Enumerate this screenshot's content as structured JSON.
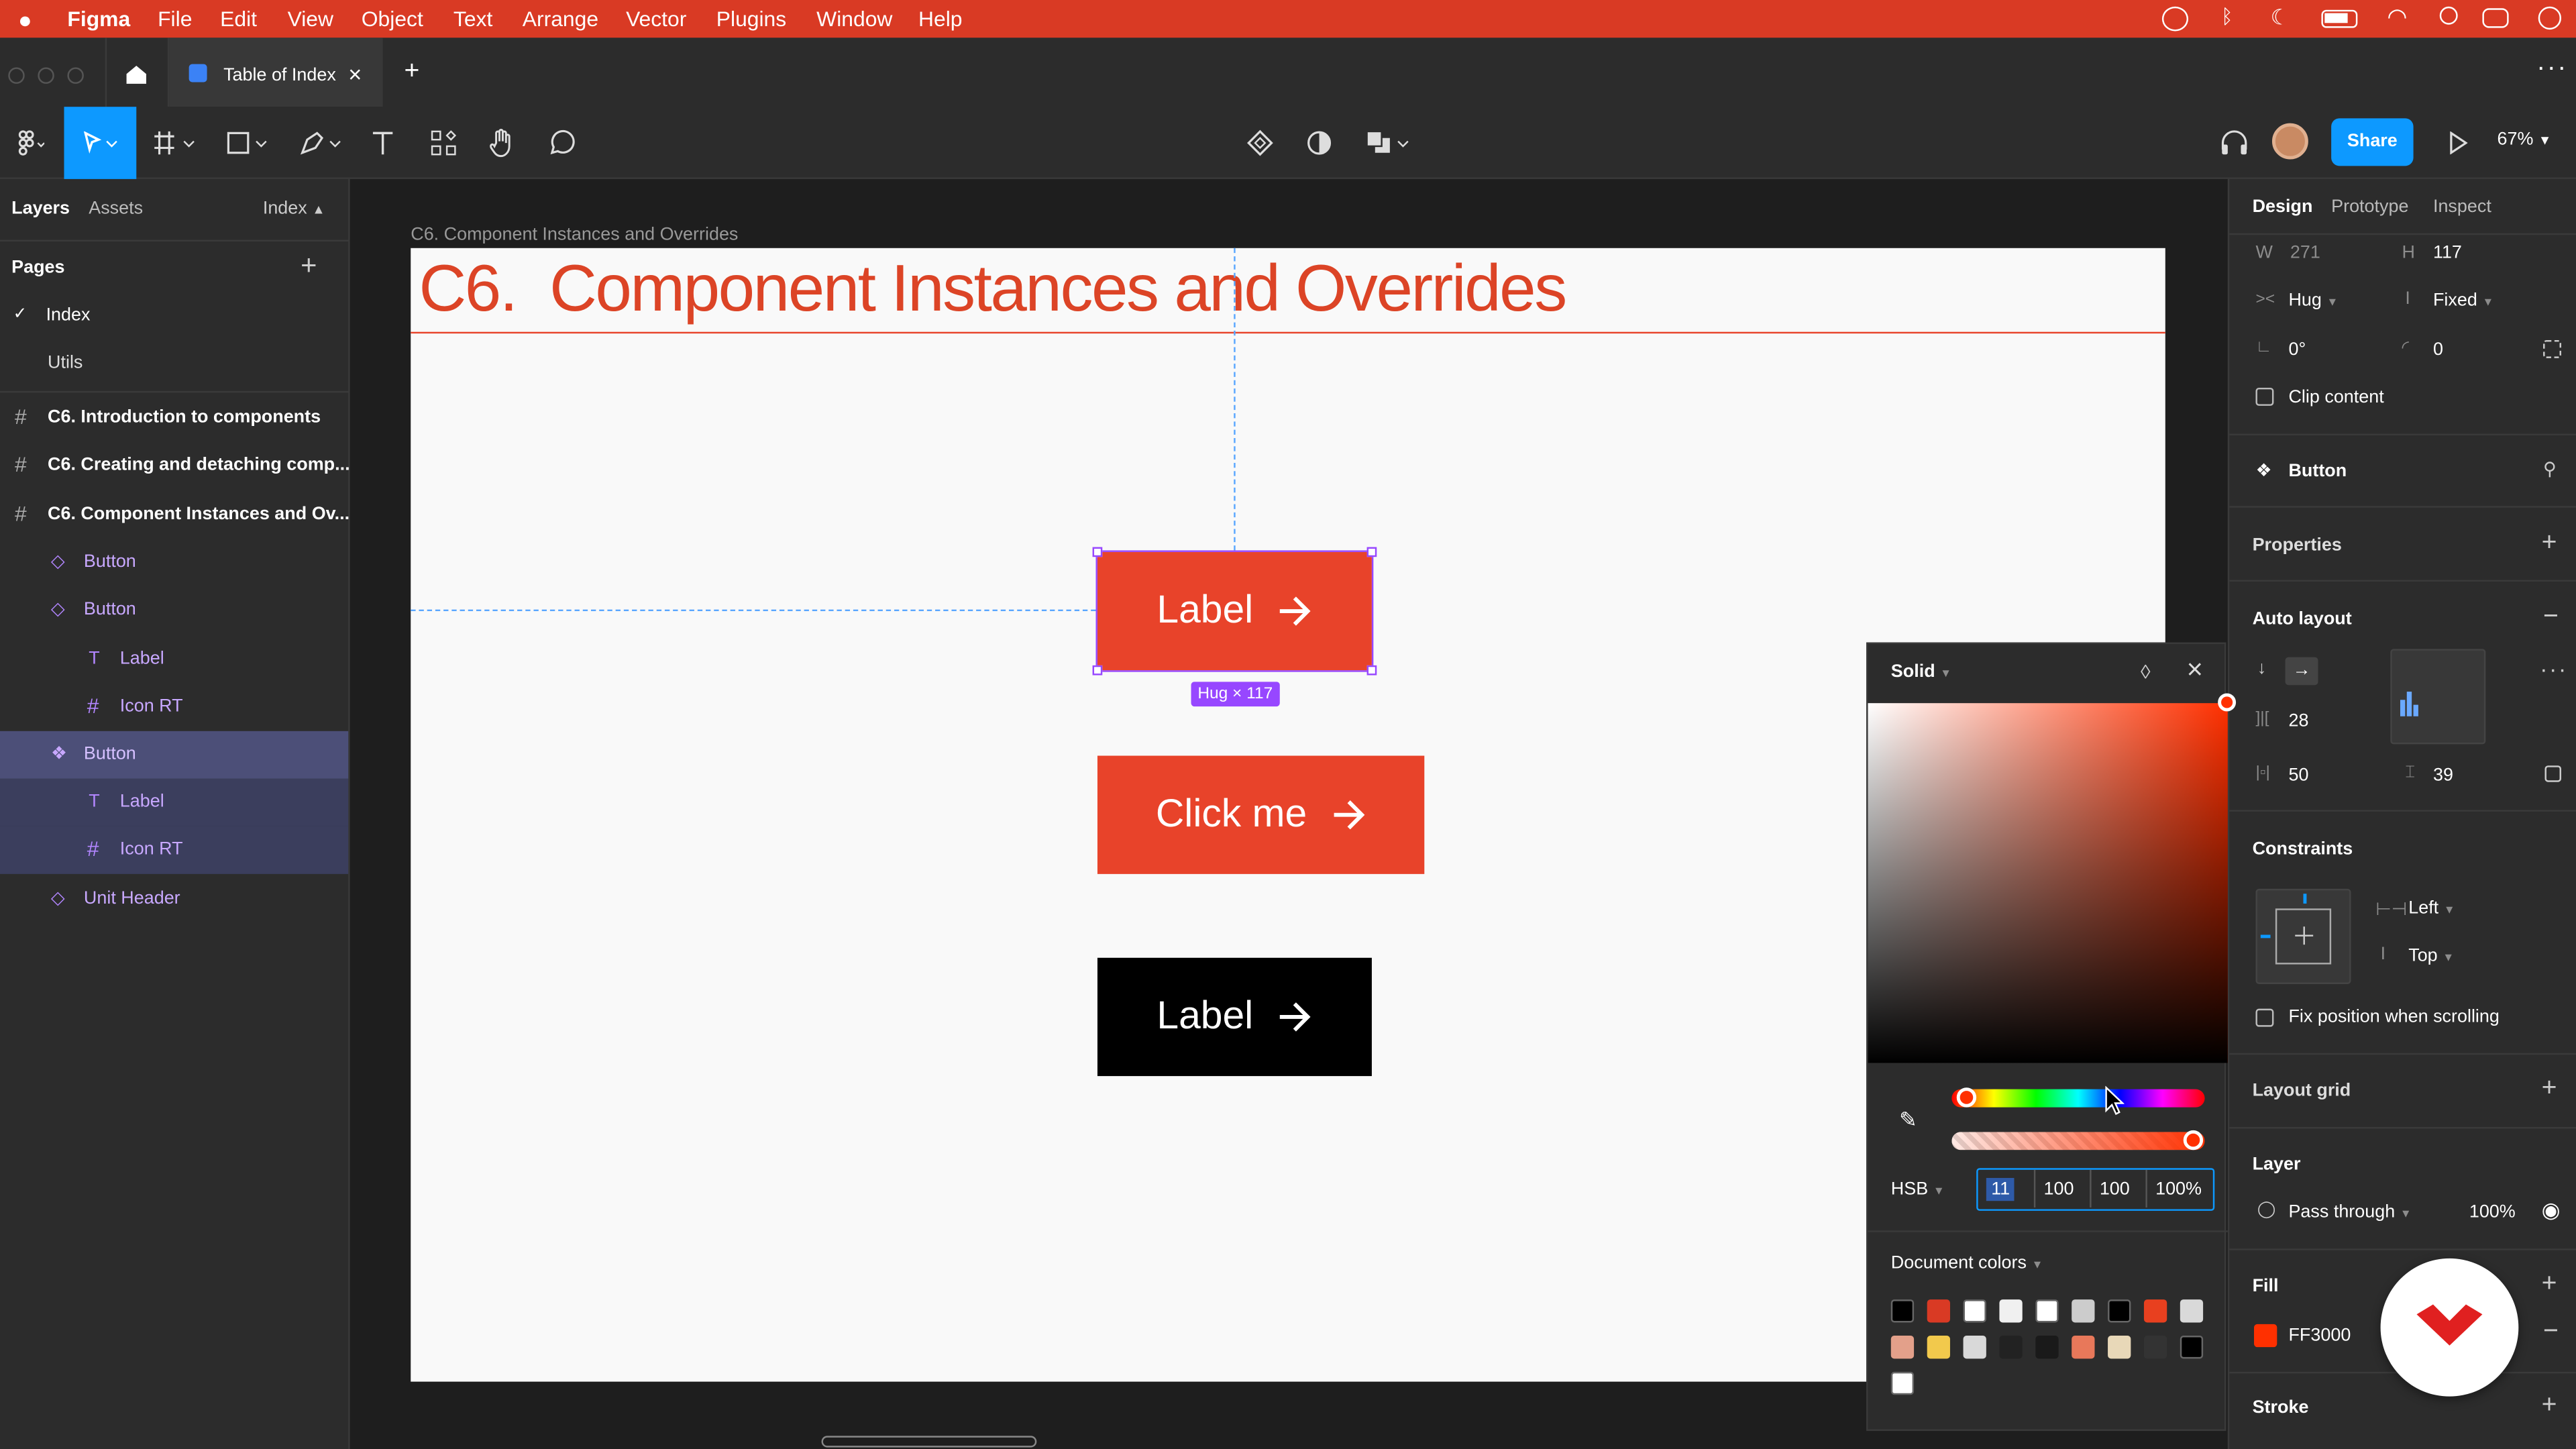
{
  "menubar": {
    "app": "Figma",
    "items": [
      "File",
      "Edit",
      "View",
      "Object",
      "Text",
      "Arrange",
      "Vector",
      "Plugins",
      "Window",
      "Help"
    ]
  },
  "tab": {
    "title": "Table of Index"
  },
  "toolbar": {
    "share": "Share",
    "zoom": "67%"
  },
  "left": {
    "tabs": {
      "layers": "Layers",
      "assets": "Assets",
      "page": "Index"
    },
    "pages_title": "Pages",
    "pages": [
      "Index",
      "Utils"
    ],
    "frames": [
      "C6. Introduction to components",
      "C6. Creating and detaching comp...",
      "C6. Component Instances and Ov..."
    ],
    "layers": [
      "Button",
      "Button",
      "Label",
      "Icon RT",
      "Button",
      "Label",
      "Icon RT",
      "Unit Header"
    ]
  },
  "canvas": {
    "frame_label": "C6. Component Instances and Overrides",
    "heading": "C6.  Component Instances and Overrides",
    "btn1": "Label",
    "btn2": "Click me",
    "btn3": "Label",
    "size_badge": "Hug × 117"
  },
  "right": {
    "tabs": [
      "Design",
      "Prototype",
      "Inspect"
    ],
    "w_label": "W",
    "w_val": "271",
    "h_label": "H",
    "h_val": "117",
    "hug": "Hug",
    "fixed": "Fixed",
    "rotation": "0°",
    "radius": "0",
    "clip": "Clip content",
    "component": "Button",
    "properties": "Properties",
    "autolayout": "Auto layout",
    "spacing": "28",
    "pad_h": "50",
    "pad_v": "39",
    "constraints": "Constraints",
    "left": "Left",
    "top": "Top",
    "fixpos": "Fix position when scrolling",
    "layoutgrid": "Layout grid",
    "layer": "Layer",
    "blend": "Pass through",
    "opacity": "100%",
    "fill": "Fill",
    "fill_hex": "FF3000",
    "stroke": "Stroke"
  },
  "picker": {
    "mode": "Solid",
    "model": "HSB",
    "h": "11",
    "s": "100",
    "b": "100",
    "a": "100%",
    "doc_colors": "Document colors",
    "swatches": [
      "#000000",
      "#d93a24",
      "#ffffff",
      "#f0f0f0",
      "#ffffff",
      "#cccccc",
      "#000000",
      "#e8401f",
      "#d9d9d9",
      "#e3a08a",
      "#f2c94c",
      "#d9d9d9",
      "#222222",
      "#1a1a1a",
      "#e8785a",
      "#e8d8b8",
      "#333333",
      "#000000",
      "#ffffff"
    ]
  },
  "colors": {
    "accent": "#0d99ff",
    "brand_red": "#e8432a",
    "menubar": "#d93a24",
    "select": "#9747ff"
  }
}
